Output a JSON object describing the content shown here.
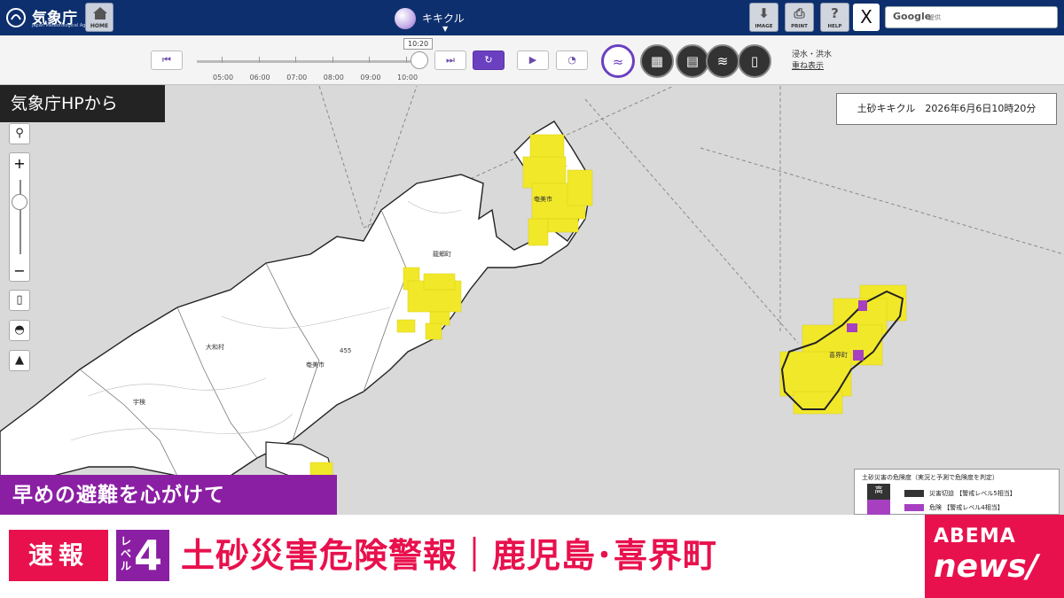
{
  "header": {
    "agency_name": "気象庁",
    "agency_name_en": "Japan Meteorological Agency",
    "home_label": "HOME",
    "center_menu_label": "キキクル",
    "tools": [
      {
        "name": "image",
        "label": "IMAGE",
        "icon": "download-icon"
      },
      {
        "name": "print",
        "label": "PRINT",
        "icon": "printer-icon"
      },
      {
        "name": "help",
        "label": "HELP",
        "icon": "help-icon"
      }
    ],
    "x_label": "X",
    "search_brand": "Google",
    "search_sub": "提供"
  },
  "timeline": {
    "current_time": "10:20",
    "ticks": [
      "05:00",
      "06:00",
      "07:00",
      "08:00",
      "09:00",
      "10:00"
    ],
    "overlay_label_1": "浸水・洪水",
    "overlay_label_2": "重ね表示"
  },
  "map": {
    "stamp": "土砂キキクル　2026年6月6日10時20分",
    "labels": {
      "amami_city": "奄美市",
      "amami_city2": "奄美市",
      "tatsugo": "龍郷町",
      "yamato": "大和村",
      "uken": "宇検",
      "kikai": "喜界町",
      "elevation": "455"
    },
    "legend": {
      "title": "土砂災害の危険度（実況と予測で危険度を判定）",
      "high_label": "高",
      "rows": [
        {
          "label": "災害切迫",
          "level": "【警戒レベル5相当】",
          "color": "#333333"
        },
        {
          "label": "危険",
          "level": "【警戒レベル4相当】",
          "color": "#a640c0"
        }
      ]
    },
    "colors": {
      "warning": "#f2e82a",
      "danger": "#a640c0",
      "land": "#ffffff",
      "sea": "#d9d9d9"
    }
  },
  "overlay": {
    "source_badge": "気象庁HPから",
    "advice": "早めの避難を心がけて",
    "breaking": "速報",
    "level_word": "レベル",
    "level_num": "4",
    "headline": "土砂災害危険警報｜鹿児島･喜界町",
    "brand_top": "ABEMA",
    "brand_bottom": "news/"
  }
}
